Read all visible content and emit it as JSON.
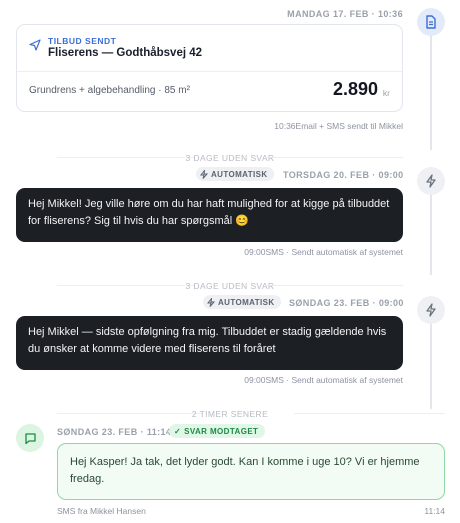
{
  "events": {
    "offer": {
      "timestamp": "MANDAG 17. FEB · 10:36",
      "tag": "TILBUD SENDT",
      "title": "Fliserens — Godthåbsvej 42",
      "description": "Grundrens + algebehandling · 85 m²",
      "price": "2.890",
      "currency": "kr",
      "footer_time": "10:36",
      "footer_text": "Email + SMS sendt til Mikkel",
      "icon": "document-icon"
    },
    "gap1": {
      "label": "3 DAGE UDEN SVAR"
    },
    "auto1": {
      "badge": "AUTOMATISK",
      "timestamp": "TORSDAG 20. FEB · 09:00",
      "message": "Hej Mikkel! Jeg ville høre om du har haft mulighed for at kigge på tilbuddet for fliserens? Sig til hvis du har spørgsmål 😊",
      "footer_time": "09:00",
      "footer_text": "SMS · Sendt automatisk af systemet",
      "icon": "bolt-icon"
    },
    "gap2": {
      "label": "3 DAGE UDEN SVAR"
    },
    "auto2": {
      "badge": "AUTOMATISK",
      "timestamp": "SØNDAG 23. FEB · 09:00",
      "message": "Hej Mikkel — sidste opfølgning fra mig. Tilbuddet er stadig gældende hvis du ønsker at komme videre med fliserens til foråret",
      "footer_time": "09:00",
      "footer_text": "SMS · Sendt automatisk af systemet",
      "icon": "bolt-icon"
    },
    "gap3": {
      "label": "2 TIMER SENERE"
    },
    "reply": {
      "timestamp": "SØNDAG 23. FEB · 11:14",
      "badge": "SVAR MODTAGET",
      "message": "Hej Kasper! Ja tak, det lyder godt. Kan I komme i uge 10? Vi er hjemme fredag.",
      "footer_left": "SMS fra Mikkel Hansen",
      "footer_right": "11:14",
      "icon": "chat-icon"
    }
  },
  "colors": {
    "accent_blue": "#3b6fd8",
    "dark_bubble": "#1c1f24",
    "reply_green": "#1e8a44",
    "rail": "#e3e6ec"
  }
}
